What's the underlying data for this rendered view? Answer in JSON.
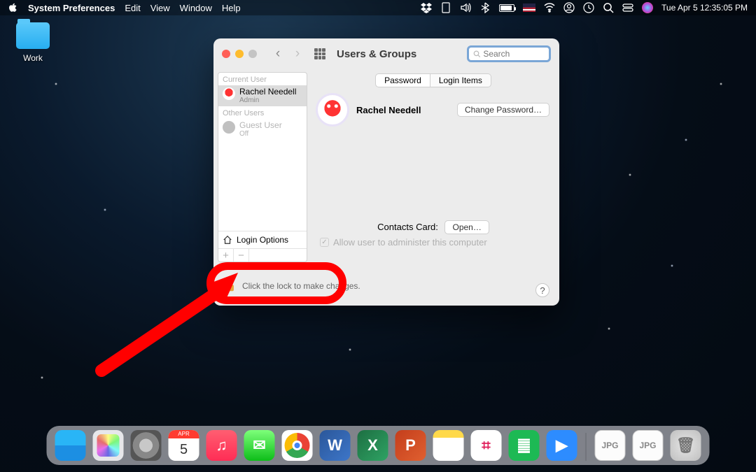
{
  "menubar": {
    "app_name": "System Preferences",
    "items": [
      "Edit",
      "View",
      "Window",
      "Help"
    ],
    "datetime": "Tue Apr 5  12:35:05 PM"
  },
  "desktop": {
    "folder_label": "Work"
  },
  "window": {
    "title": "Users & Groups",
    "search_placeholder": "Search",
    "sidebar": {
      "current_label": "Current User",
      "current_user": {
        "name": "Rachel Needell",
        "role": "Admin"
      },
      "other_label": "Other Users",
      "guest_user": {
        "name": "Guest User",
        "role": "Off"
      },
      "login_options": "Login Options"
    },
    "tabs": {
      "password": "Password",
      "login_items": "Login Items"
    },
    "main": {
      "username": "Rachel Needell",
      "change_password": "Change Password…",
      "contacts_label": "Contacts Card:",
      "open_btn": "Open…",
      "admin_checkbox": "Allow user to administer this computer"
    },
    "footer": {
      "lock_text": "Click the lock to make changes.",
      "help": "?"
    }
  },
  "dock": {
    "calendar_month": "APR",
    "calendar_day": "5"
  }
}
